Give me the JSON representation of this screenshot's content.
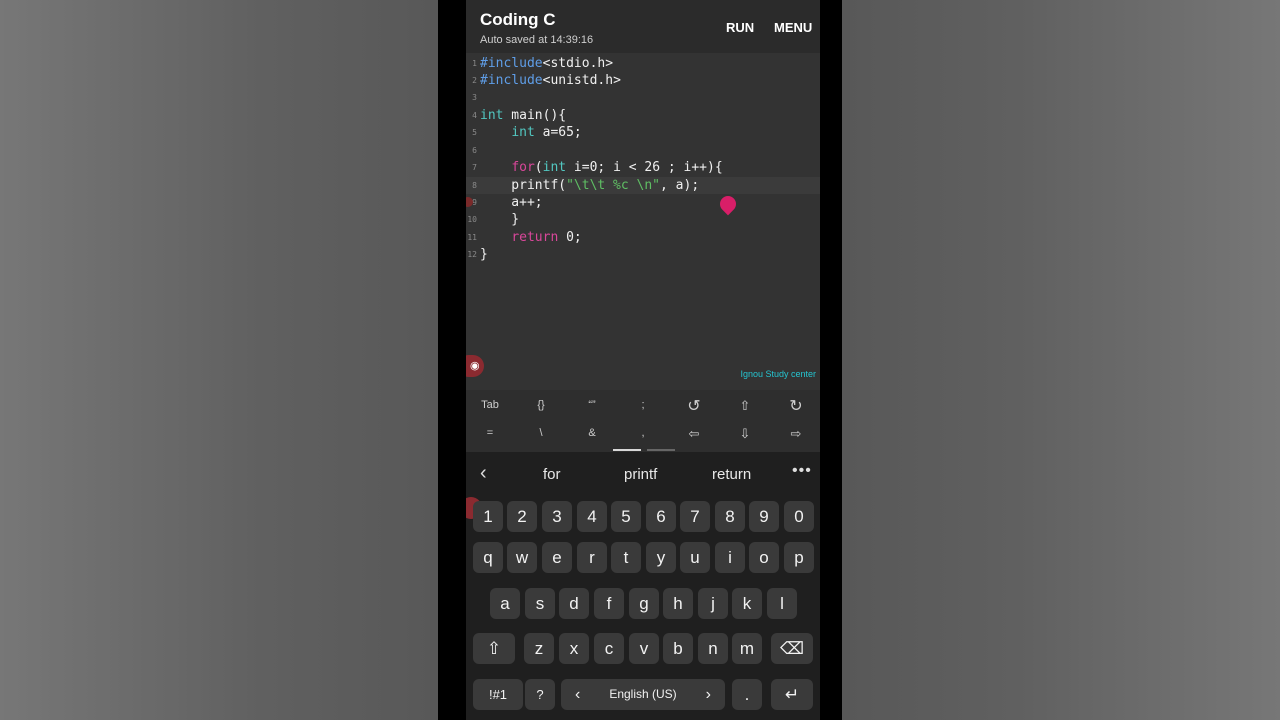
{
  "app": {
    "title": "Coding C",
    "subtitle": "Auto saved at 14:39:16",
    "run_label": "RUN",
    "menu_label": "MENU"
  },
  "editor": {
    "line_numbers": [
      "1",
      "2",
      "3",
      "4",
      "5",
      "6",
      "7",
      "8",
      "9",
      "10",
      "11",
      "12"
    ],
    "lines": [
      [
        "#include",
        "<stdio.h>"
      ],
      [
        "#include",
        "<unistd.h>"
      ],
      [],
      [
        "int",
        " main(){"
      ],
      [
        "    ",
        "int",
        " a=65;"
      ],
      [],
      [
        "    ",
        "for",
        "(",
        "int",
        " i=0; i < 26 ; i++){"
      ],
      [
        "    printf(",
        "\"\\t\\t %c \\n\"",
        ", a);"
      ],
      [
        "    a++;"
      ],
      [
        "    }"
      ],
      [
        "    ",
        "return",
        " 0;"
      ],
      [
        "}"
      ]
    ]
  },
  "watermark": "Ignou  Study  center",
  "symbols_row1": [
    "Tab",
    "{}",
    "“”",
    ";",
    "↺",
    "⇧",
    "↻"
  ],
  "symbols_row2": [
    "=",
    "\\",
    "&",
    ",",
    "⇦",
    "⇩",
    "⇨"
  ],
  "suggestions": [
    "for",
    "printf",
    "return"
  ],
  "icons": {
    "back": "chevron-left-icon",
    "more": "more-horizontal-icon",
    "camera": "camera-icon",
    "pencil": "pencil-icon",
    "shift": "shift-icon",
    "backspace": "backspace-icon",
    "enter": "enter-icon"
  },
  "keys_row_numbers": [
    "1",
    "2",
    "3",
    "4",
    "5",
    "6",
    "7",
    "8",
    "9",
    "0"
  ],
  "keys_row_q": [
    "q",
    "w",
    "e",
    "r",
    "t",
    "y",
    "u",
    "i",
    "o",
    "p"
  ],
  "keys_row_a": [
    "a",
    "s",
    "d",
    "f",
    "g",
    "h",
    "j",
    "k",
    "l"
  ],
  "keys_row_z": [
    "z",
    "x",
    "c",
    "v",
    "b",
    "n",
    "m"
  ],
  "keys_bottom": {
    "symbols": "!#1",
    "question": "?",
    "lang_prev": "‹",
    "space": "English (US)",
    "lang_next": "›",
    "period": "."
  },
  "colors": {
    "keyword_blue": "#5f9ee8",
    "keyword_cyan": "#52c7c0",
    "keyword_pink": "#d9479a",
    "string_green": "#5fbf64",
    "cursor": "#d81e68",
    "watermark": "#25c4d0"
  }
}
